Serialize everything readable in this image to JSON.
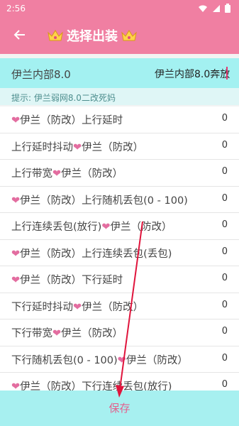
{
  "status": {
    "time": "2:56"
  },
  "appbar": {
    "title": "选择出装"
  },
  "selection": {
    "field_label": "伊兰内部8.0",
    "field_value": "伊兰内部8.0奔放"
  },
  "hint": "提示: 伊兰弱网8.0二改死妈",
  "items": [
    {
      "prefix": "",
      "heart": "❤",
      "label": "伊兰（防改）上行延时",
      "count": "0"
    },
    {
      "prefix": "上行延时抖动",
      "heart": "❤",
      "label": "伊兰（防改）",
      "count": "0"
    },
    {
      "prefix": "上行带宽",
      "heart": "❤",
      "label": "伊兰（防改）",
      "count": "0"
    },
    {
      "prefix": "",
      "heart": "❤",
      "label": "伊兰（防改）上行随机丢包(0 - 100)",
      "count": "0"
    },
    {
      "prefix": "上行连续丢包(放行)",
      "heart": "❤",
      "label": "伊兰（防改）",
      "count": "0"
    },
    {
      "prefix": "",
      "heart": "❤",
      "label": "伊兰（防改）上行连续丢包(丢包)",
      "count": "0"
    },
    {
      "prefix": "",
      "heart": "❤",
      "label": "伊兰（防改）下行延时",
      "count": "0"
    },
    {
      "prefix": "下行延时抖动",
      "heart": "❤",
      "label": "伊兰（防改）",
      "count": "0"
    },
    {
      "prefix": "下行带宽",
      "heart": "❤",
      "label": "伊兰（防改）",
      "count": "0"
    },
    {
      "prefix": "下行随机丢包(0 - 100)",
      "heart": "❤",
      "label": "伊兰（防改）",
      "count": "0"
    },
    {
      "prefix": "",
      "heart": "❤",
      "label": "伊兰（防改）下行连续丢包(放行)",
      "count": "0"
    }
  ],
  "save_label": "保存",
  "colors": {
    "appbar": "#f07fa2",
    "input_bg": "#a3f1f1",
    "hint_bg": "#dff6f6",
    "save_bg": "#a7f0f0",
    "accent_pink": "#e36da0",
    "arrow_red": "#e0143c"
  }
}
